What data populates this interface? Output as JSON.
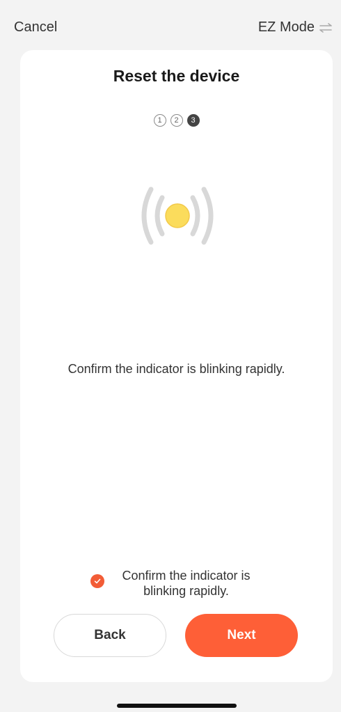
{
  "topbar": {
    "cancel_label": "Cancel",
    "mode_label": "EZ Mode",
    "mode_icon": "swap-arrows-icon"
  },
  "card": {
    "title": "Reset the device",
    "steps": [
      {
        "label": "1",
        "active": false
      },
      {
        "label": "2",
        "active": false
      },
      {
        "label": "3",
        "active": true
      }
    ],
    "description": "Confirm the indicator is blinking rapidly.",
    "confirm": {
      "checked": true,
      "text": "Confirm the indicator is blinking rapidly."
    },
    "buttons": {
      "back_label": "Back",
      "next_label": "Next"
    }
  },
  "colors": {
    "accent": "#fe5f37",
    "checkbox": "#f25c36",
    "indicator_light": "#fbdc5c",
    "signal_waves": "#d8d8d8",
    "card_background": "#ffffff",
    "page_background": "#f3f3f3"
  }
}
